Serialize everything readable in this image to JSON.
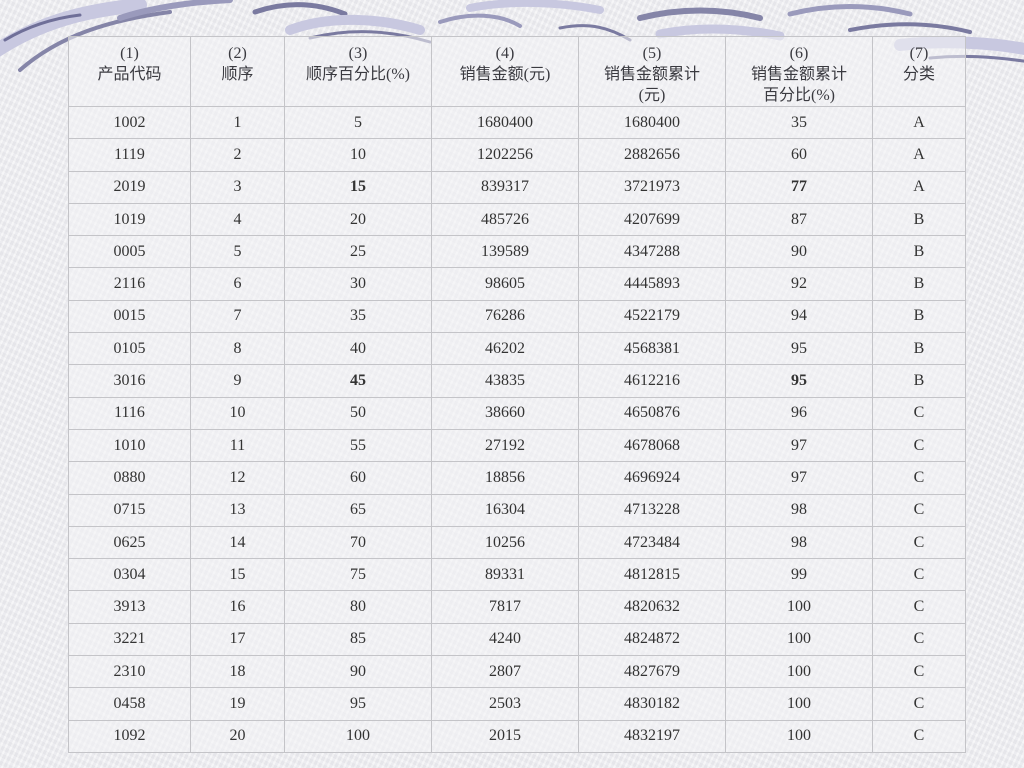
{
  "table": {
    "headers": [
      {
        "num": "(1)",
        "label": "产品代码"
      },
      {
        "num": "(2)",
        "label": "顺序"
      },
      {
        "num": "(3)",
        "label": "顺序百分比(%)"
      },
      {
        "num": "(4)",
        "label": "销售金额(元)"
      },
      {
        "num": "(5)",
        "label": "销售金额累计(元)"
      },
      {
        "num": "(6)",
        "label": "销售金额累计百分比(%)"
      },
      {
        "num": "(7)",
        "label": "分类"
      }
    ],
    "rows": [
      [
        "1002",
        "1",
        "5",
        "1680400",
        "1680400",
        "35",
        "A"
      ],
      [
        "1119",
        "2",
        "10",
        "1202256",
        "2882656",
        "60",
        "A"
      ],
      [
        "2019",
        "3",
        "15",
        "839317",
        "3721973",
        "77",
        "A"
      ],
      [
        "1019",
        "4",
        "20",
        "485726",
        "4207699",
        "87",
        "B"
      ],
      [
        "0005",
        "5",
        "25",
        "139589",
        "4347288",
        "90",
        "B"
      ],
      [
        "2116",
        "6",
        "30",
        "98605",
        "4445893",
        "92",
        "B"
      ],
      [
        "0015",
        "7",
        "35",
        "76286",
        "4522179",
        "94",
        "B"
      ],
      [
        "0105",
        "8",
        "40",
        "46202",
        "4568381",
        "95",
        "B"
      ],
      [
        "3016",
        "9",
        "45",
        "43835",
        "4612216",
        "95",
        "B"
      ],
      [
        "1116",
        "10",
        "50",
        "38660",
        "4650876",
        "96",
        "C"
      ],
      [
        "1010",
        "11",
        "55",
        "27192",
        "4678068",
        "97",
        "C"
      ],
      [
        "0880",
        "12",
        "60",
        "18856",
        "4696924",
        "97",
        "C"
      ],
      [
        "0715",
        "13",
        "65",
        "16304",
        "4713228",
        "98",
        "C"
      ],
      [
        "0625",
        "14",
        "70",
        "10256",
        "4723484",
        "98",
        "C"
      ],
      [
        "0304",
        "15",
        "75",
        "89331",
        "4812815",
        "99",
        "C"
      ],
      [
        "3913",
        "16",
        "80",
        "7817",
        "4820632",
        "100",
        "C"
      ],
      [
        "3221",
        "17",
        "85",
        "4240",
        "4824872",
        "100",
        "C"
      ],
      [
        "2310",
        "18",
        "90",
        "2807",
        "4827679",
        "100",
        "C"
      ],
      [
        "0458",
        "19",
        "95",
        "2503",
        "4830182",
        "100",
        "C"
      ],
      [
        "1092",
        "20",
        "100",
        "2015",
        "4832197",
        "100",
        "C"
      ]
    ],
    "bold_rows": [
      2,
      8
    ],
    "bold_cols": [
      2,
      5
    ]
  },
  "colors": {
    "swirl_dark": "#7a7aa0",
    "swirl_light": "#c8c8e0",
    "grid": "#c4c4c8",
    "text": "#333333"
  }
}
